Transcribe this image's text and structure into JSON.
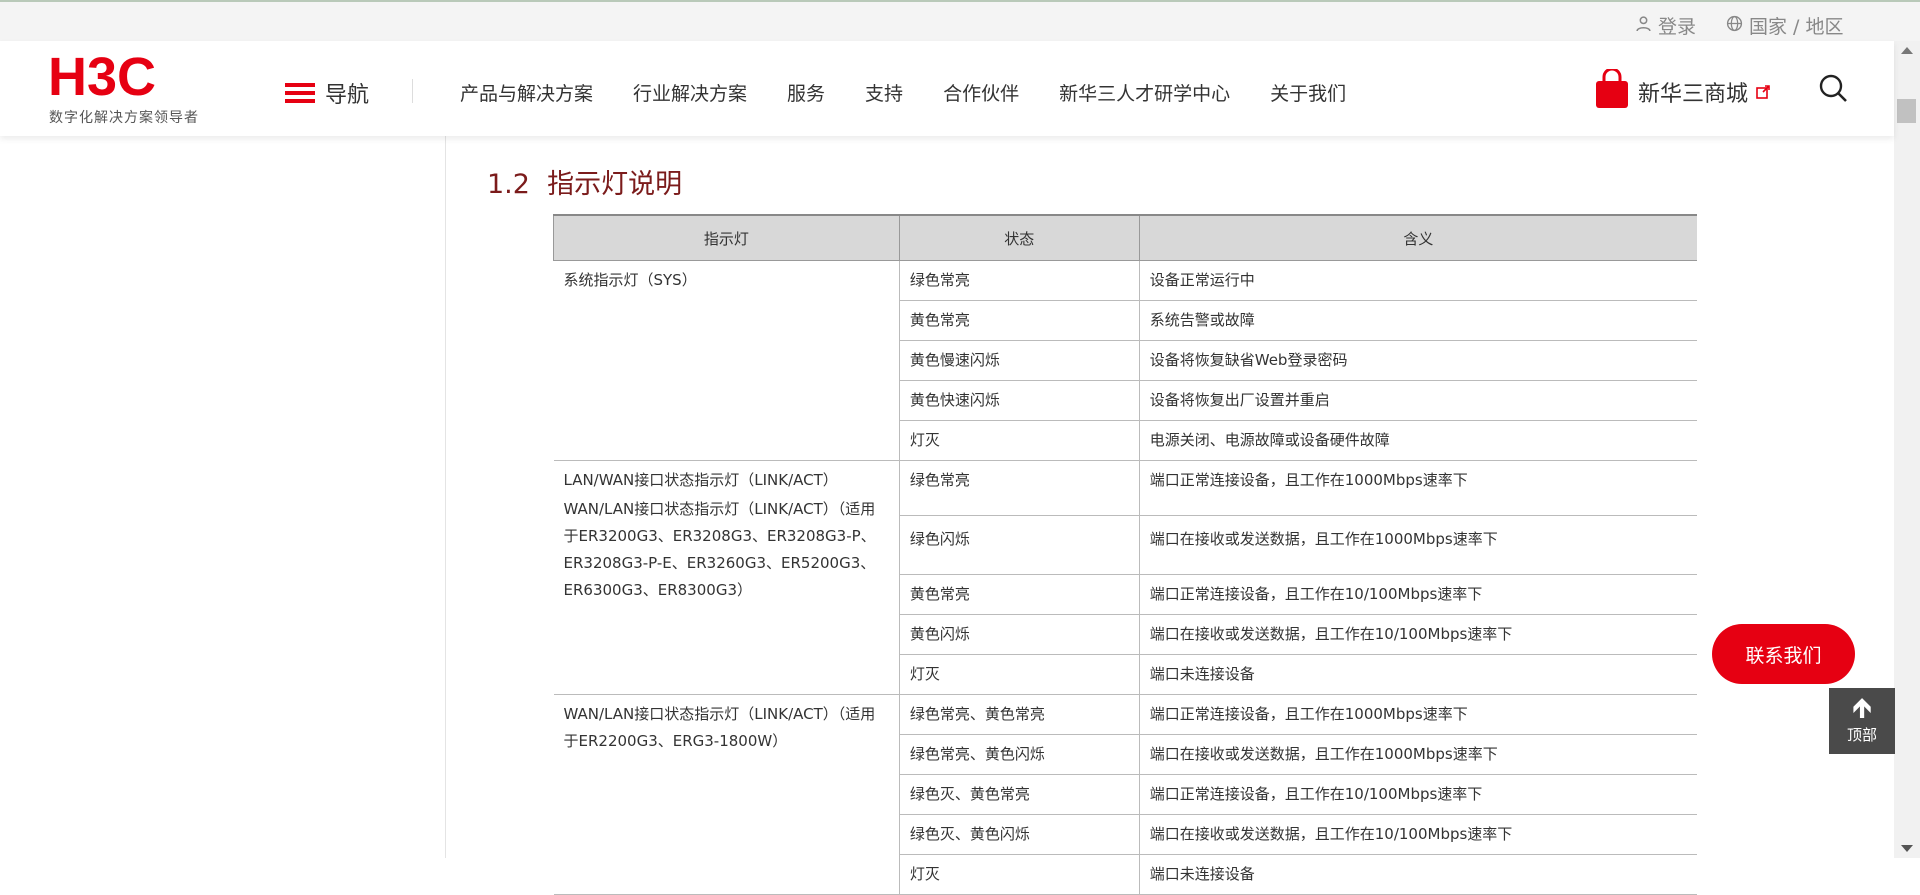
{
  "util": {
    "login": "登录",
    "region": "国家 / 地区"
  },
  "header": {
    "logo_text": "H3C",
    "logo_tagline": "数字化解决方案领导者",
    "menu_label": "导航",
    "nav": [
      "产品与解决方案",
      "行业解决方案",
      "服务",
      "支持",
      "合作伙伴",
      "新华三人才研学中心",
      "关于我们"
    ],
    "mall_label": "新华三商城"
  },
  "section": {
    "number": "1.2",
    "title": "指示灯说明"
  },
  "table": {
    "headers": [
      "指示灯",
      "状态",
      "含义"
    ],
    "groups": [
      {
        "indicator": [
          "系统指示灯（SYS）"
        ],
        "rows": [
          [
            "绿色常亮",
            "设备正常运行中"
          ],
          [
            "黄色常亮",
            "系统告警或故障"
          ],
          [
            "黄色慢速闪烁",
            "设备将恢复缺省Web登录密码"
          ],
          [
            "黄色快速闪烁",
            "设备将恢复出厂设置并重启"
          ],
          [
            "灯灭",
            "电源关闭、电源故障或设备硬件故障"
          ]
        ]
      },
      {
        "indicator": [
          "LAN/WAN接口状态指示灯（LINK/ACT）",
          "WAN/LAN接口状态指示灯（LINK/ACT）（适用于ER3200G3、ER3208G3、ER3208G3-P、ER3208G3-P-E、ER3260G3、ER5200G3、ER6300G3、ER8300G3）"
        ],
        "rows": [
          [
            "绿色常亮",
            "端口正常连接设备，且工作在1000Mbps速率下"
          ],
          [
            "绿色闪烁",
            "端口在接收或发送数据，且工作在1000Mbps速率下"
          ],
          [
            "黄色常亮",
            "端口正常连接设备，且工作在10/100Mbps速率下"
          ],
          [
            "黄色闪烁",
            "端口在接收或发送数据，且工作在10/100Mbps速率下"
          ],
          [
            "灯灭",
            "端口未连接设备"
          ]
        ]
      },
      {
        "indicator": [
          "WAN/LAN接口状态指示灯（LINK/ACT）（适用于ER2200G3、ERG3-1800W）"
        ],
        "rows": [
          [
            "绿色常亮、黄色常亮",
            "端口正常连接设备，且工作在1000Mbps速率下"
          ],
          [
            "绿色常亮、黄色闪烁",
            "端口在接收或发送数据，且工作在1000Mbps速率下"
          ],
          [
            "绿色灭、黄色常亮",
            "端口正常连接设备，且工作在10/100Mbps速率下"
          ],
          [
            "绿色灭、黄色闪烁",
            "端口在接收或发送数据，且工作在10/100Mbps速率下"
          ],
          [
            "灯灭",
            "端口未连接设备"
          ]
        ]
      }
    ]
  },
  "float": {
    "contact": "联系我们",
    "top": "顶部"
  },
  "colors": {
    "brand": "#e60012",
    "section_title": "#7b1b1b"
  }
}
